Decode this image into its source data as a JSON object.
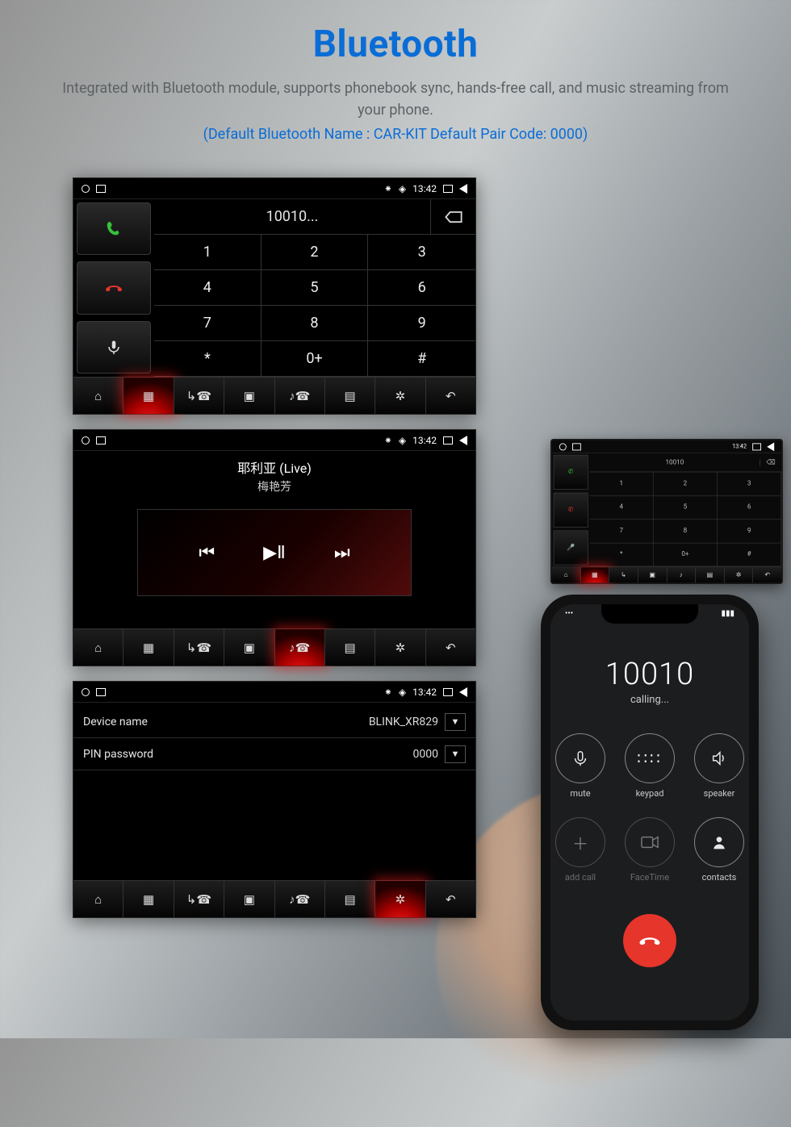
{
  "header": {
    "title": "Bluetooth",
    "subtitle": "Integrated with Bluetooth module, supports phonebook sync, hands-free call, and music streaming from your phone.",
    "default_note": "(Default Bluetooth Name : CAR-KIT   Default Pair Code: 0000)"
  },
  "status": {
    "time": "13:42"
  },
  "dialer": {
    "display": "10010...",
    "keys": [
      "1",
      "2",
      "3",
      "4",
      "5",
      "6",
      "7",
      "8",
      "9",
      "*",
      "0+",
      "#"
    ]
  },
  "music": {
    "title": "耶利亚 (Live)",
    "artist": "梅艳芳"
  },
  "settings": {
    "device_label": "Device name",
    "device_value": "BLINK_XR829",
    "pin_label": "PIN password",
    "pin_value": "0000"
  },
  "dash": {
    "display": "10010"
  },
  "phone": {
    "status_left": "•••",
    "status_right": "▮▮▮",
    "number": "10010",
    "calling": "calling...",
    "buttons": [
      {
        "label": "mute",
        "icon": "mic"
      },
      {
        "label": "keypad",
        "icon": "keypad"
      },
      {
        "label": "speaker",
        "icon": "speaker"
      },
      {
        "label": "add call",
        "icon": "plus"
      },
      {
        "label": "FaceTime",
        "icon": "facetime"
      },
      {
        "label": "contacts",
        "icon": "contacts"
      }
    ]
  }
}
